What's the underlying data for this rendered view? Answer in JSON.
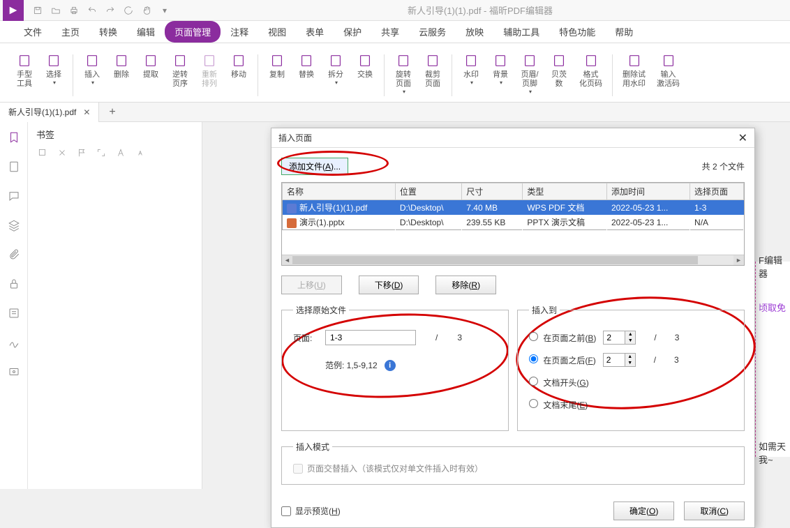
{
  "app": {
    "window_title": "新人引导(1)(1).pdf - 福昕PDF编辑器"
  },
  "menu": {
    "items": [
      "文件",
      "主页",
      "转换",
      "编辑",
      "页面管理",
      "注释",
      "视图",
      "表单",
      "保护",
      "共享",
      "云服务",
      "放映",
      "辅助工具",
      "特色功能",
      "帮助"
    ],
    "active_index": 4
  },
  "ribbon": {
    "buttons": [
      {
        "label": "手型\n工具"
      },
      {
        "label": "选择",
        "drop": true
      },
      {
        "label": "插入",
        "drop": true
      },
      {
        "label": "删除"
      },
      {
        "label": "提取"
      },
      {
        "label": "逆转\n页序"
      },
      {
        "label": "重新\n排列",
        "disabled": true
      },
      {
        "label": "移动"
      },
      {
        "label": "复制"
      },
      {
        "label": "替换"
      },
      {
        "label": "拆分",
        "drop": true
      },
      {
        "label": "交换"
      },
      {
        "label": "旋转\n页面",
        "drop": true
      },
      {
        "label": "裁剪\n页面"
      },
      {
        "label": "水印",
        "drop": true
      },
      {
        "label": "背景",
        "drop": true
      },
      {
        "label": "页眉/\n页脚",
        "drop": true
      },
      {
        "label": "贝茨\n数"
      },
      {
        "label": "格式\n化页码"
      },
      {
        "label": "删除试\n用水印"
      },
      {
        "label": "输入\n激活码"
      }
    ]
  },
  "tabs": {
    "open": [
      {
        "title": "新人引导(1)(1).pdf"
      }
    ],
    "add": "+"
  },
  "bookmarks": {
    "panel_title": "书签"
  },
  "right_peek": {
    "t1": "F编辑器",
    "t2": "顷取免",
    "t3": "如需天",
    "t4": "我~"
  },
  "modal": {
    "title": "插入页面",
    "add_file_btn": "添加文件",
    "add_file_key": "A",
    "file_count": "共 2 个文件",
    "columns": [
      "名称",
      "位置",
      "尺寸",
      "类型",
      "添加时间",
      "选择页面"
    ],
    "rows": [
      {
        "name": "新人引导(1)(1).pdf",
        "loc": "D:\\Desktop\\",
        "size": "7.40 MB",
        "type": "WPS PDF 文档",
        "time": "2022-05-23 1...",
        "pages": "1-3",
        "selected": true,
        "kind": "pdf"
      },
      {
        "name": "演示(1).pptx",
        "loc": "D:\\Desktop\\",
        "size": "239.55 KB",
        "type": "PPTX 演示文稿",
        "time": "2022-05-23 1...",
        "pages": "N/A",
        "selected": false,
        "kind": "pptx"
      }
    ],
    "btns": {
      "up": "上移",
      "up_key": "U",
      "down": "下移",
      "down_key": "D",
      "remove": "移除",
      "remove_key": "R"
    },
    "src": {
      "legend": "选择原始文件",
      "page_label": "页面:",
      "page_value": "1-3",
      "total": "3",
      "example": "范例: 1,5-9,12"
    },
    "dest": {
      "legend": "插入到",
      "opt_before": "在页面之前",
      "opt_before_key": "B",
      "opt_after": "在页面之后",
      "opt_after_key": "F",
      "opt_start": "文档开头",
      "opt_start_key": "G",
      "opt_end": "文档末尾",
      "opt_end_key": "E",
      "before_val": "2",
      "before_total": "3",
      "after_val": "2",
      "after_total": "3",
      "checked": "after"
    },
    "mode": {
      "legend": "插入模式",
      "chk_label": "页面交替插入（该模式仅对单文件插入时有效）"
    },
    "footer": {
      "preview": "显示预览",
      "preview_key": "H",
      "ok": "确定",
      "ok_key": "O",
      "cancel": "取消",
      "cancel_key": "C"
    }
  }
}
